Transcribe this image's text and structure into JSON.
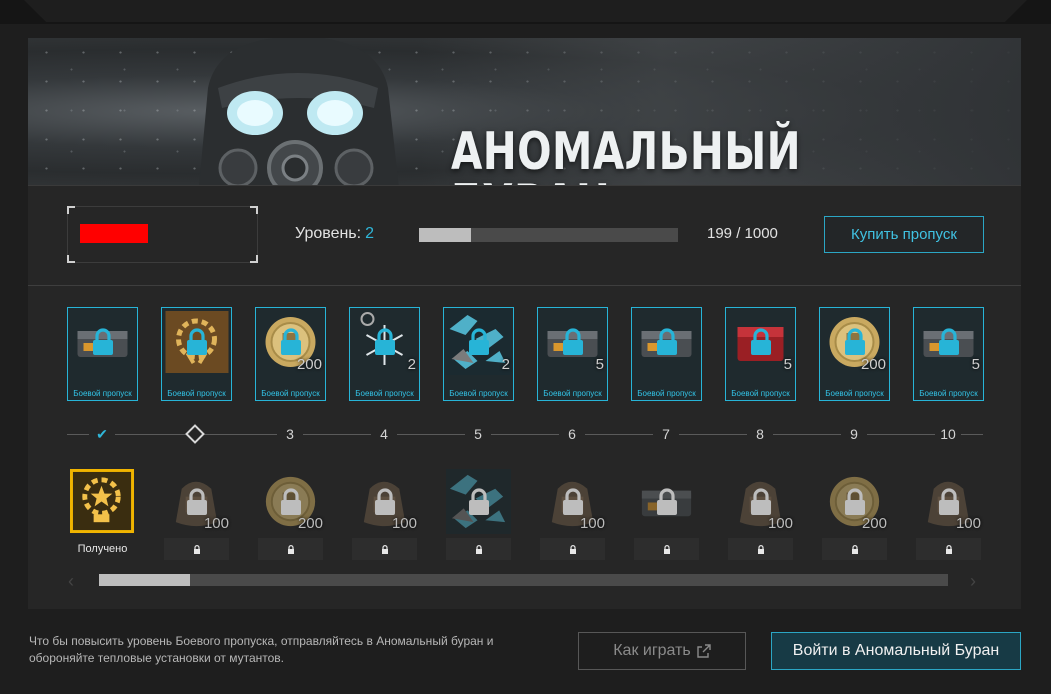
{
  "banner": {
    "title": "АНОМАЛЬНЫЙ БУРАН"
  },
  "profile": {
    "level_label": "Уровень:",
    "level_value": "2",
    "xp_text": "199 / 1000",
    "xp_progress": 0.199
  },
  "buy_button": "Купить пропуск",
  "premium_rewards": [
    {
      "icon": "crate-icon",
      "qty": "",
      "caption": "Боевой пропуск"
    },
    {
      "icon": "laurel-badge-icon",
      "qty": "",
      "caption": "Боевой пропуск"
    },
    {
      "icon": "coin-icon",
      "qty": "200",
      "caption": "Боевой пропуск"
    },
    {
      "icon": "snowflake-charm-icon",
      "qty": "2",
      "caption": "Боевой пропуск"
    },
    {
      "icon": "camo-skin-icon",
      "qty": "2",
      "caption": "Боевой пропуск"
    },
    {
      "icon": "crate-icon",
      "qty": "5",
      "caption": "Боевой пропуск"
    },
    {
      "icon": "crate-icon",
      "qty": "",
      "caption": "Боевой пропуск"
    },
    {
      "icon": "red-box-icon",
      "qty": "5",
      "caption": "Боевой пропуск"
    },
    {
      "icon": "coin-icon",
      "qty": "200",
      "caption": "Боевой пропуск"
    },
    {
      "icon": "crate-icon",
      "qty": "5",
      "caption": "Боевой пропуск"
    }
  ],
  "levels": [
    "1",
    "2",
    "3",
    "4",
    "5",
    "6",
    "7",
    "8",
    "9",
    "10"
  ],
  "free_rewards": [
    {
      "icon": "gold-badge-icon",
      "qty": "",
      "status": "Получено"
    },
    {
      "icon": "bag-icon",
      "qty": "100",
      "status": ""
    },
    {
      "icon": "coin-icon",
      "qty": "200",
      "status": ""
    },
    {
      "icon": "bag-icon",
      "qty": "100",
      "status": ""
    },
    {
      "icon": "camo-skin-icon",
      "qty": "",
      "status": ""
    },
    {
      "icon": "bag-icon",
      "qty": "100",
      "status": ""
    },
    {
      "icon": "crate-icon",
      "qty": "",
      "status": ""
    },
    {
      "icon": "bag-icon",
      "qty": "100",
      "status": ""
    },
    {
      "icon": "coin-icon",
      "qty": "200",
      "status": ""
    },
    {
      "icon": "bag-icon",
      "qty": "100",
      "status": ""
    }
  ],
  "footer": {
    "hint": "Что бы повысить уровень Боевого пропуска, отправляйтесь в Аномальный буран и обороняйте тепловые установки от мутантов.",
    "how_to_play": "Как играть",
    "enter": "Войти в Аномальный Буран"
  },
  "colors": {
    "accent": "#2fb6d8",
    "enter_bg": "#173a45"
  }
}
